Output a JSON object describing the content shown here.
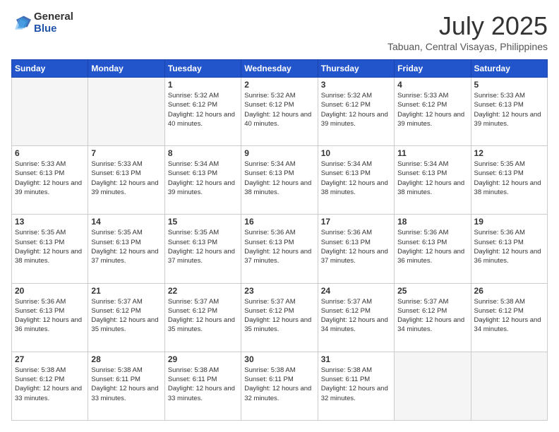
{
  "logo": {
    "general": "General",
    "blue": "Blue"
  },
  "header": {
    "title": "July 2025",
    "subtitle": "Tabuan, Central Visayas, Philippines"
  },
  "days": [
    "Sunday",
    "Monday",
    "Tuesday",
    "Wednesday",
    "Thursday",
    "Friday",
    "Saturday"
  ],
  "weeks": [
    [
      {
        "day": "",
        "empty": true
      },
      {
        "day": "",
        "empty": true
      },
      {
        "day": "1",
        "sunrise": "Sunrise: 5:32 AM",
        "sunset": "Sunset: 6:12 PM",
        "daylight": "Daylight: 12 hours and 40 minutes."
      },
      {
        "day": "2",
        "sunrise": "Sunrise: 5:32 AM",
        "sunset": "Sunset: 6:12 PM",
        "daylight": "Daylight: 12 hours and 40 minutes."
      },
      {
        "day": "3",
        "sunrise": "Sunrise: 5:32 AM",
        "sunset": "Sunset: 6:12 PM",
        "daylight": "Daylight: 12 hours and 39 minutes."
      },
      {
        "day": "4",
        "sunrise": "Sunrise: 5:33 AM",
        "sunset": "Sunset: 6:12 PM",
        "daylight": "Daylight: 12 hours and 39 minutes."
      },
      {
        "day": "5",
        "sunrise": "Sunrise: 5:33 AM",
        "sunset": "Sunset: 6:13 PM",
        "daylight": "Daylight: 12 hours and 39 minutes."
      }
    ],
    [
      {
        "day": "6",
        "sunrise": "Sunrise: 5:33 AM",
        "sunset": "Sunset: 6:13 PM",
        "daylight": "Daylight: 12 hours and 39 minutes."
      },
      {
        "day": "7",
        "sunrise": "Sunrise: 5:33 AM",
        "sunset": "Sunset: 6:13 PM",
        "daylight": "Daylight: 12 hours and 39 minutes."
      },
      {
        "day": "8",
        "sunrise": "Sunrise: 5:34 AM",
        "sunset": "Sunset: 6:13 PM",
        "daylight": "Daylight: 12 hours and 39 minutes."
      },
      {
        "day": "9",
        "sunrise": "Sunrise: 5:34 AM",
        "sunset": "Sunset: 6:13 PM",
        "daylight": "Daylight: 12 hours and 38 minutes."
      },
      {
        "day": "10",
        "sunrise": "Sunrise: 5:34 AM",
        "sunset": "Sunset: 6:13 PM",
        "daylight": "Daylight: 12 hours and 38 minutes."
      },
      {
        "day": "11",
        "sunrise": "Sunrise: 5:34 AM",
        "sunset": "Sunset: 6:13 PM",
        "daylight": "Daylight: 12 hours and 38 minutes."
      },
      {
        "day": "12",
        "sunrise": "Sunrise: 5:35 AM",
        "sunset": "Sunset: 6:13 PM",
        "daylight": "Daylight: 12 hours and 38 minutes."
      }
    ],
    [
      {
        "day": "13",
        "sunrise": "Sunrise: 5:35 AM",
        "sunset": "Sunset: 6:13 PM",
        "daylight": "Daylight: 12 hours and 38 minutes."
      },
      {
        "day": "14",
        "sunrise": "Sunrise: 5:35 AM",
        "sunset": "Sunset: 6:13 PM",
        "daylight": "Daylight: 12 hours and 37 minutes."
      },
      {
        "day": "15",
        "sunrise": "Sunrise: 5:35 AM",
        "sunset": "Sunset: 6:13 PM",
        "daylight": "Daylight: 12 hours and 37 minutes."
      },
      {
        "day": "16",
        "sunrise": "Sunrise: 5:36 AM",
        "sunset": "Sunset: 6:13 PM",
        "daylight": "Daylight: 12 hours and 37 minutes."
      },
      {
        "day": "17",
        "sunrise": "Sunrise: 5:36 AM",
        "sunset": "Sunset: 6:13 PM",
        "daylight": "Daylight: 12 hours and 37 minutes."
      },
      {
        "day": "18",
        "sunrise": "Sunrise: 5:36 AM",
        "sunset": "Sunset: 6:13 PM",
        "daylight": "Daylight: 12 hours and 36 minutes."
      },
      {
        "day": "19",
        "sunrise": "Sunrise: 5:36 AM",
        "sunset": "Sunset: 6:13 PM",
        "daylight": "Daylight: 12 hours and 36 minutes."
      }
    ],
    [
      {
        "day": "20",
        "sunrise": "Sunrise: 5:36 AM",
        "sunset": "Sunset: 6:13 PM",
        "daylight": "Daylight: 12 hours and 36 minutes."
      },
      {
        "day": "21",
        "sunrise": "Sunrise: 5:37 AM",
        "sunset": "Sunset: 6:12 PM",
        "daylight": "Daylight: 12 hours and 35 minutes."
      },
      {
        "day": "22",
        "sunrise": "Sunrise: 5:37 AM",
        "sunset": "Sunset: 6:12 PM",
        "daylight": "Daylight: 12 hours and 35 minutes."
      },
      {
        "day": "23",
        "sunrise": "Sunrise: 5:37 AM",
        "sunset": "Sunset: 6:12 PM",
        "daylight": "Daylight: 12 hours and 35 minutes."
      },
      {
        "day": "24",
        "sunrise": "Sunrise: 5:37 AM",
        "sunset": "Sunset: 6:12 PM",
        "daylight": "Daylight: 12 hours and 34 minutes."
      },
      {
        "day": "25",
        "sunrise": "Sunrise: 5:37 AM",
        "sunset": "Sunset: 6:12 PM",
        "daylight": "Daylight: 12 hours and 34 minutes."
      },
      {
        "day": "26",
        "sunrise": "Sunrise: 5:38 AM",
        "sunset": "Sunset: 6:12 PM",
        "daylight": "Daylight: 12 hours and 34 minutes."
      }
    ],
    [
      {
        "day": "27",
        "sunrise": "Sunrise: 5:38 AM",
        "sunset": "Sunset: 6:12 PM",
        "daylight": "Daylight: 12 hours and 33 minutes."
      },
      {
        "day": "28",
        "sunrise": "Sunrise: 5:38 AM",
        "sunset": "Sunset: 6:11 PM",
        "daylight": "Daylight: 12 hours and 33 minutes."
      },
      {
        "day": "29",
        "sunrise": "Sunrise: 5:38 AM",
        "sunset": "Sunset: 6:11 PM",
        "daylight": "Daylight: 12 hours and 33 minutes."
      },
      {
        "day": "30",
        "sunrise": "Sunrise: 5:38 AM",
        "sunset": "Sunset: 6:11 PM",
        "daylight": "Daylight: 12 hours and 32 minutes."
      },
      {
        "day": "31",
        "sunrise": "Sunrise: 5:38 AM",
        "sunset": "Sunset: 6:11 PM",
        "daylight": "Daylight: 12 hours and 32 minutes."
      },
      {
        "day": "",
        "empty": true
      },
      {
        "day": "",
        "empty": true
      }
    ]
  ]
}
